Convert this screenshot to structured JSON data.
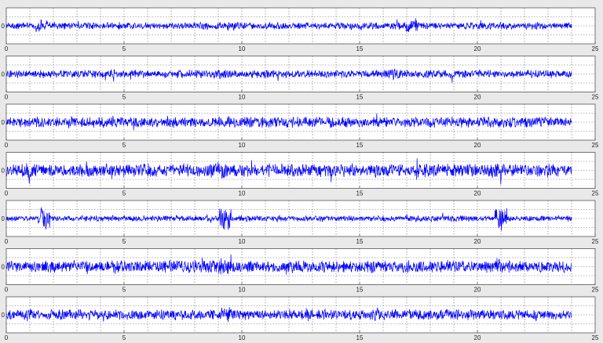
{
  "colors": {
    "background": "#e9e9e9",
    "axes_face": "#ffffff",
    "axes_edge": "#555555",
    "grid": "#6a6a6a",
    "signal": "#0000ff",
    "tick_text": "#222222"
  },
  "chart_data": [
    {
      "type": "line",
      "name": "",
      "xlim": [
        0,
        25
      ],
      "ylim": [
        -1,
        1
      ],
      "xticks": [
        0,
        5,
        10,
        15,
        20,
        25
      ],
      "yticks": [
        0
      ],
      "grid": true,
      "x_end": 24,
      "amplitude": 0.22,
      "bursts": [
        [
          1.5,
          0.35
        ],
        [
          9.6,
          0.3
        ],
        [
          17.2,
          0.45
        ]
      ]
    },
    {
      "type": "line",
      "name": "",
      "xlim": [
        0,
        25
      ],
      "ylim": [
        -1,
        1
      ],
      "xticks": [
        0,
        5,
        10,
        15,
        20,
        25
      ],
      "yticks": [
        0
      ],
      "grid": true,
      "x_end": 24,
      "amplitude": 0.25,
      "bursts": [
        [
          9.2,
          0.35
        ],
        [
          16.5,
          0.35
        ]
      ]
    },
    {
      "type": "line",
      "name": "",
      "xlim": [
        0,
        25
      ],
      "ylim": [
        -1,
        1
      ],
      "xticks": [
        0,
        5,
        10,
        15,
        20,
        25
      ],
      "yticks": [
        0
      ],
      "grid": true,
      "x_end": 24,
      "amplitude": 0.33,
      "bursts": [
        [
          9.5,
          0.4
        ],
        [
          10.8,
          0.35
        ]
      ]
    },
    {
      "type": "line",
      "name": "",
      "xlim": [
        0,
        25
      ],
      "ylim": [
        -1,
        1
      ],
      "xticks": [
        0,
        5,
        10,
        15,
        20,
        25
      ],
      "yticks": [
        0
      ],
      "grid": true,
      "x_end": 24,
      "amplitude": 0.4,
      "bursts": [
        [
          1.0,
          0.5
        ],
        [
          9.1,
          0.6
        ],
        [
          20.8,
          0.5
        ]
      ]
    },
    {
      "type": "line",
      "name": "",
      "xlim": [
        0,
        25
      ],
      "ylim": [
        -1,
        1
      ],
      "xticks": [
        0,
        5,
        10,
        15,
        20,
        25
      ],
      "yticks": [
        0
      ],
      "grid": true,
      "x_end": 24,
      "amplitude": 0.18,
      "bursts": [
        [
          1.6,
          0.7
        ],
        [
          9.3,
          0.8
        ],
        [
          21.0,
          0.7
        ]
      ]
    },
    {
      "type": "line",
      "name": "",
      "xlim": [
        0,
        25
      ],
      "ylim": [
        -1,
        1
      ],
      "xticks": [
        0,
        5,
        10,
        15,
        20,
        25
      ],
      "yticks": [
        0
      ],
      "grid": true,
      "x_end": 24,
      "amplitude": 0.38,
      "bursts": [
        [
          9.2,
          0.6
        ],
        [
          21.0,
          0.55
        ]
      ]
    },
    {
      "type": "line",
      "name": "",
      "xlim": [
        0,
        25
      ],
      "ylim": [
        -1,
        1
      ],
      "xticks": [
        0,
        5,
        10,
        15,
        20,
        25
      ],
      "yticks": [
        0
      ],
      "grid": true,
      "x_end": 24,
      "amplitude": 0.32,
      "bursts": [
        [
          0.9,
          0.4
        ],
        [
          9.4,
          0.45
        ],
        [
          15.8,
          0.45
        ]
      ]
    }
  ]
}
